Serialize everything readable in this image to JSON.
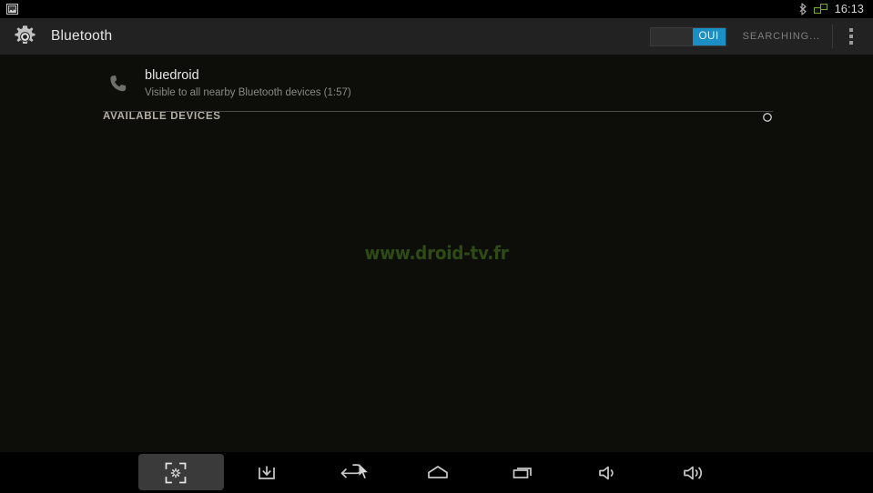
{
  "status_bar": {
    "left_icons": [
      {
        "name": "screenshot-notification-icon",
        "label": "screenshot-notification"
      }
    ],
    "right_icons": [
      {
        "name": "bluetooth-status-icon",
        "label": "bluetooth"
      },
      {
        "name": "ethernet-status-icon",
        "label": "ethernet"
      }
    ],
    "clock": "16:13",
    "background_color": "#000000"
  },
  "action_bar": {
    "app_icon": "settings-gear-icon",
    "title": "Bluetooth",
    "toggle": {
      "state_label": "OUI",
      "checked": true,
      "on_color": "#1b8fc4",
      "off_color": "#2e2e2e"
    },
    "status_text": "SEARCHING...",
    "overflow_menu_icon": "overflow-menu-icon",
    "background_color": "#222222"
  },
  "content": {
    "local_device": {
      "icon": "phone-handset-icon",
      "name": "bluedroid",
      "subtitle": "Visible to all nearby Bluetooth devices (1:57)"
    },
    "section": {
      "title": "AVAILABLE DEVICES",
      "spinner_icon": "loading-spinner-icon",
      "devices": []
    },
    "watermark": "www.droid-tv.fr",
    "watermark_color": "#2e4a16",
    "background_color": "#0d0d09"
  },
  "nav_bar": {
    "background_color": "#000000",
    "buttons": [
      {
        "name": "screenshot-button",
        "label": "Screenshot",
        "selected": true
      },
      {
        "name": "download-button",
        "label": "Download",
        "selected": false
      },
      {
        "name": "back-button",
        "label": "Back",
        "selected": false
      },
      {
        "name": "home-button",
        "label": "Home",
        "selected": false
      },
      {
        "name": "recent-apps-button",
        "label": "Recent apps",
        "selected": false
      },
      {
        "name": "volume-down-button",
        "label": "Volume down",
        "selected": false
      },
      {
        "name": "volume-up-button",
        "label": "Volume up",
        "selected": false
      }
    ],
    "cursor": "mouse-cursor"
  }
}
